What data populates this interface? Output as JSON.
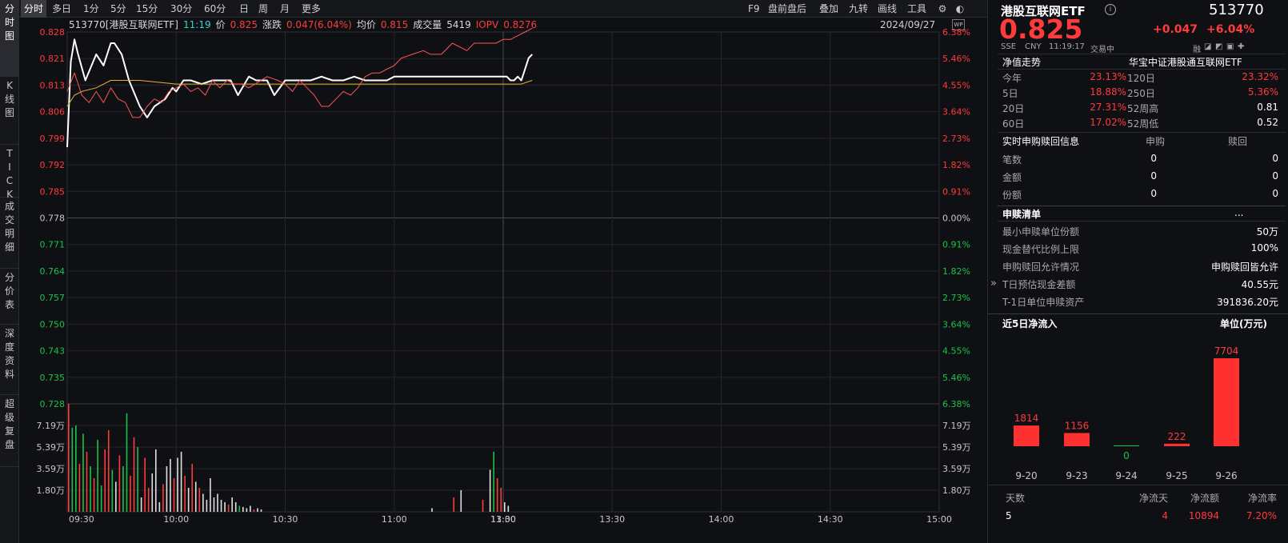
{
  "vertical_tabs": [
    {
      "label": "分时图",
      "chars": [
        "分",
        "时",
        "图"
      ],
      "active": true
    },
    {
      "label": "K线图",
      "chars": [
        "K",
        "线",
        "图"
      ],
      "active": false
    },
    {
      "label": "TICK",
      "chars": [
        "T",
        "I",
        "C",
        "K"
      ],
      "active": false
    },
    {
      "label": "成交明细",
      "chars": [
        "成",
        "交",
        "明",
        "细"
      ],
      "active": false
    },
    {
      "label": "分价表",
      "chars": [
        "分",
        "价",
        "表"
      ],
      "active": false
    },
    {
      "label": "深度资料",
      "chars": [
        "深",
        "度",
        "资",
        "料"
      ],
      "active": false
    },
    {
      "label": "超级复盘",
      "chars": [
        "超",
        "级",
        "复",
        "盘"
      ],
      "active": false
    }
  ],
  "toolbar": {
    "periods": [
      "分时",
      "多日",
      "1分",
      "5分",
      "15分",
      "30分",
      "60分",
      "日",
      "周",
      "月",
      "更多"
    ],
    "active_period": "分时",
    "right_items": [
      "F9",
      "盘前盘后",
      "叠加",
      "九转",
      "画线",
      "工具"
    ],
    "icons": [
      "gear-icon",
      "skin-icon"
    ]
  },
  "chart_info": {
    "name": "513770[港股互联网ETF]",
    "time": "11:19",
    "price_label": "价",
    "price": "0.825",
    "change_label": "涨跌",
    "change": "0.047(6.04%)",
    "avg_label": "均价",
    "avg": "0.815",
    "volume_label": "成交量",
    "volume": "5419",
    "iopv_label": "IOPV",
    "iopv": "0.8276",
    "date": "2024/09/27",
    "wp_label": "WP"
  },
  "chart_data": {
    "type": "line",
    "prev_close": 0.778,
    "y_ticks_price": [
      "0.828",
      "0.821",
      "0.813",
      "0.806",
      "0.799",
      "0.792",
      "0.785",
      "0.778",
      "0.771",
      "0.764",
      "0.757",
      "0.750",
      "0.743",
      "0.735",
      "0.728"
    ],
    "y_ticks_pct": [
      "6.38%",
      "5.46%",
      "4.55%",
      "3.64%",
      "2.73%",
      "1.82%",
      "0.91%",
      "0.00%",
      "0.91%",
      "1.82%",
      "2.73%",
      "3.64%",
      "4.55%",
      "5.46%",
      "6.38%"
    ],
    "ylim": [
      0.728,
      0.828
    ],
    "x_ticks": [
      "09:30",
      "10:00",
      "10:30",
      "11:00",
      "11:30",
      "13:00",
      "13:30",
      "14:00",
      "14:30",
      "15:00"
    ],
    "volume_ticks": [
      "7.19万",
      "5.39万",
      "3.59万",
      "1.80万"
    ],
    "volume_max": 89900,
    "series": [
      {
        "name": "价",
        "color": "#ffffff",
        "x": [
          0,
          1,
          2,
          3,
          5,
          8,
          10,
          12,
          13,
          15,
          17,
          20,
          22,
          24,
          27,
          29,
          30,
          32,
          34,
          37,
          40,
          43,
          45,
          47,
          50,
          52,
          55,
          57,
          60,
          62,
          65,
          67,
          70,
          73,
          76,
          79,
          82,
          85,
          88,
          90,
          95,
          100,
          105,
          110,
          112,
          115,
          117,
          119,
          120,
          121,
          122,
          123,
          124,
          125,
          127,
          128
        ],
        "values": [
          0.797,
          0.82,
          0.826,
          0.822,
          0.815,
          0.822,
          0.819,
          0.825,
          0.825,
          0.822,
          0.815,
          0.808,
          0.805,
          0.808,
          0.81,
          0.813,
          0.812,
          0.815,
          0.815,
          0.814,
          0.815,
          0.815,
          0.815,
          0.811,
          0.816,
          0.815,
          0.815,
          0.811,
          0.815,
          0.815,
          0.815,
          0.815,
          0.816,
          0.815,
          0.815,
          0.816,
          0.815,
          0.815,
          0.815,
          0.816,
          0.816,
          0.816,
          0.816,
          0.816,
          0.816,
          0.816,
          0.816,
          0.816,
          0.816,
          0.816,
          0.815,
          0.815,
          0.816,
          0.815,
          0.821,
          0.822
        ]
      },
      {
        "name": "均价",
        "color": "#e8b03a",
        "x": [
          0,
          2,
          4,
          8,
          12,
          20,
          30,
          40,
          50,
          60,
          70,
          80,
          90,
          100,
          110,
          118,
          121,
          125,
          128
        ],
        "values": [
          0.808,
          0.811,
          0.812,
          0.813,
          0.815,
          0.815,
          0.814,
          0.814,
          0.814,
          0.814,
          0.814,
          0.814,
          0.814,
          0.814,
          0.814,
          0.814,
          0.814,
          0.814,
          0.815
        ]
      },
      {
        "name": "IOPV",
        "color": "#ff5555",
        "x": [
          0,
          2,
          4,
          6,
          8,
          10,
          12,
          14,
          16,
          18,
          20,
          22,
          24,
          26,
          28,
          30,
          32,
          34,
          36,
          38,
          40,
          42,
          44,
          46,
          48,
          50,
          55,
          58,
          60,
          62,
          64,
          66,
          68,
          70,
          72,
          74,
          76,
          78,
          80,
          82,
          84,
          86,
          88,
          90,
          92,
          95,
          98,
          100,
          103,
          106,
          108,
          110,
          112,
          115,
          118,
          120,
          122,
          124,
          126,
          128
        ],
        "values": [
          0.812,
          0.817,
          0.811,
          0.809,
          0.812,
          0.809,
          0.813,
          0.81,
          0.809,
          0.805,
          0.805,
          0.808,
          0.81,
          0.809,
          0.812,
          0.813,
          0.814,
          0.812,
          0.813,
          0.811,
          0.815,
          0.813,
          0.815,
          0.814,
          0.814,
          0.813,
          0.816,
          0.815,
          0.814,
          0.812,
          0.815,
          0.813,
          0.811,
          0.808,
          0.808,
          0.81,
          0.812,
          0.811,
          0.813,
          0.816,
          0.817,
          0.817,
          0.818,
          0.819,
          0.821,
          0.822,
          0.823,
          0.822,
          0.822,
          0.825,
          0.824,
          0.823,
          0.825,
          0.825,
          0.825,
          0.826,
          0.826,
          0.827,
          0.828,
          0.829
        ]
      }
    ],
    "volume": {
      "x": [
        0,
        1,
        2,
        3,
        4,
        5,
        6,
        7,
        8,
        9,
        10,
        11,
        12,
        13,
        14,
        15,
        16,
        17,
        18,
        19,
        20,
        21,
        22,
        23,
        24,
        25,
        26,
        27,
        28,
        29,
        30,
        31,
        32,
        33,
        34,
        35,
        36,
        37,
        38,
        39,
        40,
        41,
        42,
        43,
        44,
        45,
        46,
        47,
        48,
        49,
        50,
        51,
        52,
        53,
        100,
        106,
        108,
        114,
        116,
        117,
        118,
        119,
        120,
        121
      ],
      "values": [
        89900,
        70000,
        72000,
        40000,
        65000,
        50000,
        38000,
        28000,
        60000,
        22000,
        52000,
        68000,
        35000,
        25000,
        47000,
        38000,
        82000,
        30000,
        62000,
        54000,
        12000,
        45000,
        20000,
        32000,
        52000,
        8000,
        23000,
        38000,
        44000,
        28000,
        45000,
        50000,
        30000,
        20000,
        40000,
        25000,
        20000,
        15000,
        10000,
        28000,
        12000,
        15000,
        10000,
        8000,
        6000,
        12000,
        8000,
        5000,
        4000,
        3000,
        5000,
        2000,
        3000,
        2000,
        3000,
        12000,
        18000,
        10000,
        35000,
        50000,
        28000,
        20000,
        8000,
        5000
      ],
      "colors": [
        "r",
        "g",
        "g",
        "r",
        "g",
        "r",
        "g",
        "r",
        "g",
        "g",
        "r",
        "r",
        "g",
        "w",
        "r",
        "g",
        "g",
        "r",
        "r",
        "g",
        "w",
        "r",
        "r",
        "w",
        "w",
        "w",
        "r",
        "w",
        "w",
        "r",
        "w",
        "w",
        "r",
        "w",
        "r",
        "w",
        "r",
        "w",
        "w",
        "w",
        "w",
        "w",
        "w",
        "w",
        "r",
        "w",
        "w",
        "g",
        "w",
        "w",
        "w",
        "r",
        "w",
        "w",
        "w",
        "r",
        "w",
        "r",
        "w",
        "g",
        "r",
        "r",
        "w",
        "w"
      ]
    }
  },
  "panel": {
    "title": "港股互联网ETF",
    "code": "513770",
    "price": "0.825",
    "change": "+0.047",
    "change_pct": "+6.04%",
    "exchange": "SSE",
    "currency": "CNY",
    "time": "11:19:17",
    "status": "交易中",
    "margin_badge": "融",
    "nav_title": "净值走势",
    "nav_index": "华宝中证港股通互联网ETF",
    "nav_rows": [
      {
        "l1": "今年",
        "v1": "23.13%",
        "l2": "120日",
        "v2": "23.32%"
      },
      {
        "l1": "5日",
        "v1": "18.88%",
        "l2": "250日",
        "v2": "5.36%"
      },
      {
        "l1": "20日",
        "v1": "27.31%",
        "l2": "52周高",
        "v2": "0.81"
      },
      {
        "l1": "60日",
        "v1": "17.02%",
        "l2": "52周低",
        "v2": "0.52"
      }
    ],
    "sub_title": "实时申购赎回信息",
    "sub_col1": "申购",
    "sub_col2": "赎回",
    "sub_rows": [
      {
        "label": "笔数",
        "v1": "0",
        "v2": "0"
      },
      {
        "label": "金额",
        "v1": "0",
        "v2": "0"
      },
      {
        "label": "份额",
        "v1": "0",
        "v2": "0"
      }
    ],
    "list_title": "申赎清单",
    "list_more": "...",
    "list_rows": [
      {
        "label": "最小申赎单位份额",
        "value": "50万"
      },
      {
        "label": "现金替代比例上限",
        "value": "100%"
      },
      {
        "label": "申购赎回允许情况",
        "value": "申购赎回皆允许"
      },
      {
        "label": "T日预估现金差额",
        "value": "40.55元"
      },
      {
        "label": "T-1日单位申赎资产",
        "value": "391836.20元"
      }
    ],
    "collapse_icon": "»",
    "flow_title": "近5日净流入",
    "flow_unit": "单位(万元)",
    "flow_chart": {
      "type": "bar",
      "categories": [
        "9-20",
        "9-23",
        "9-24",
        "9-25",
        "9-26"
      ],
      "values": [
        1814,
        1156,
        0,
        222,
        7704
      ]
    },
    "stats_headers": [
      "天数",
      "净流天",
      "净流额",
      "净流率"
    ],
    "stats_values": [
      "5",
      "4",
      "10894",
      "7.20%"
    ]
  }
}
